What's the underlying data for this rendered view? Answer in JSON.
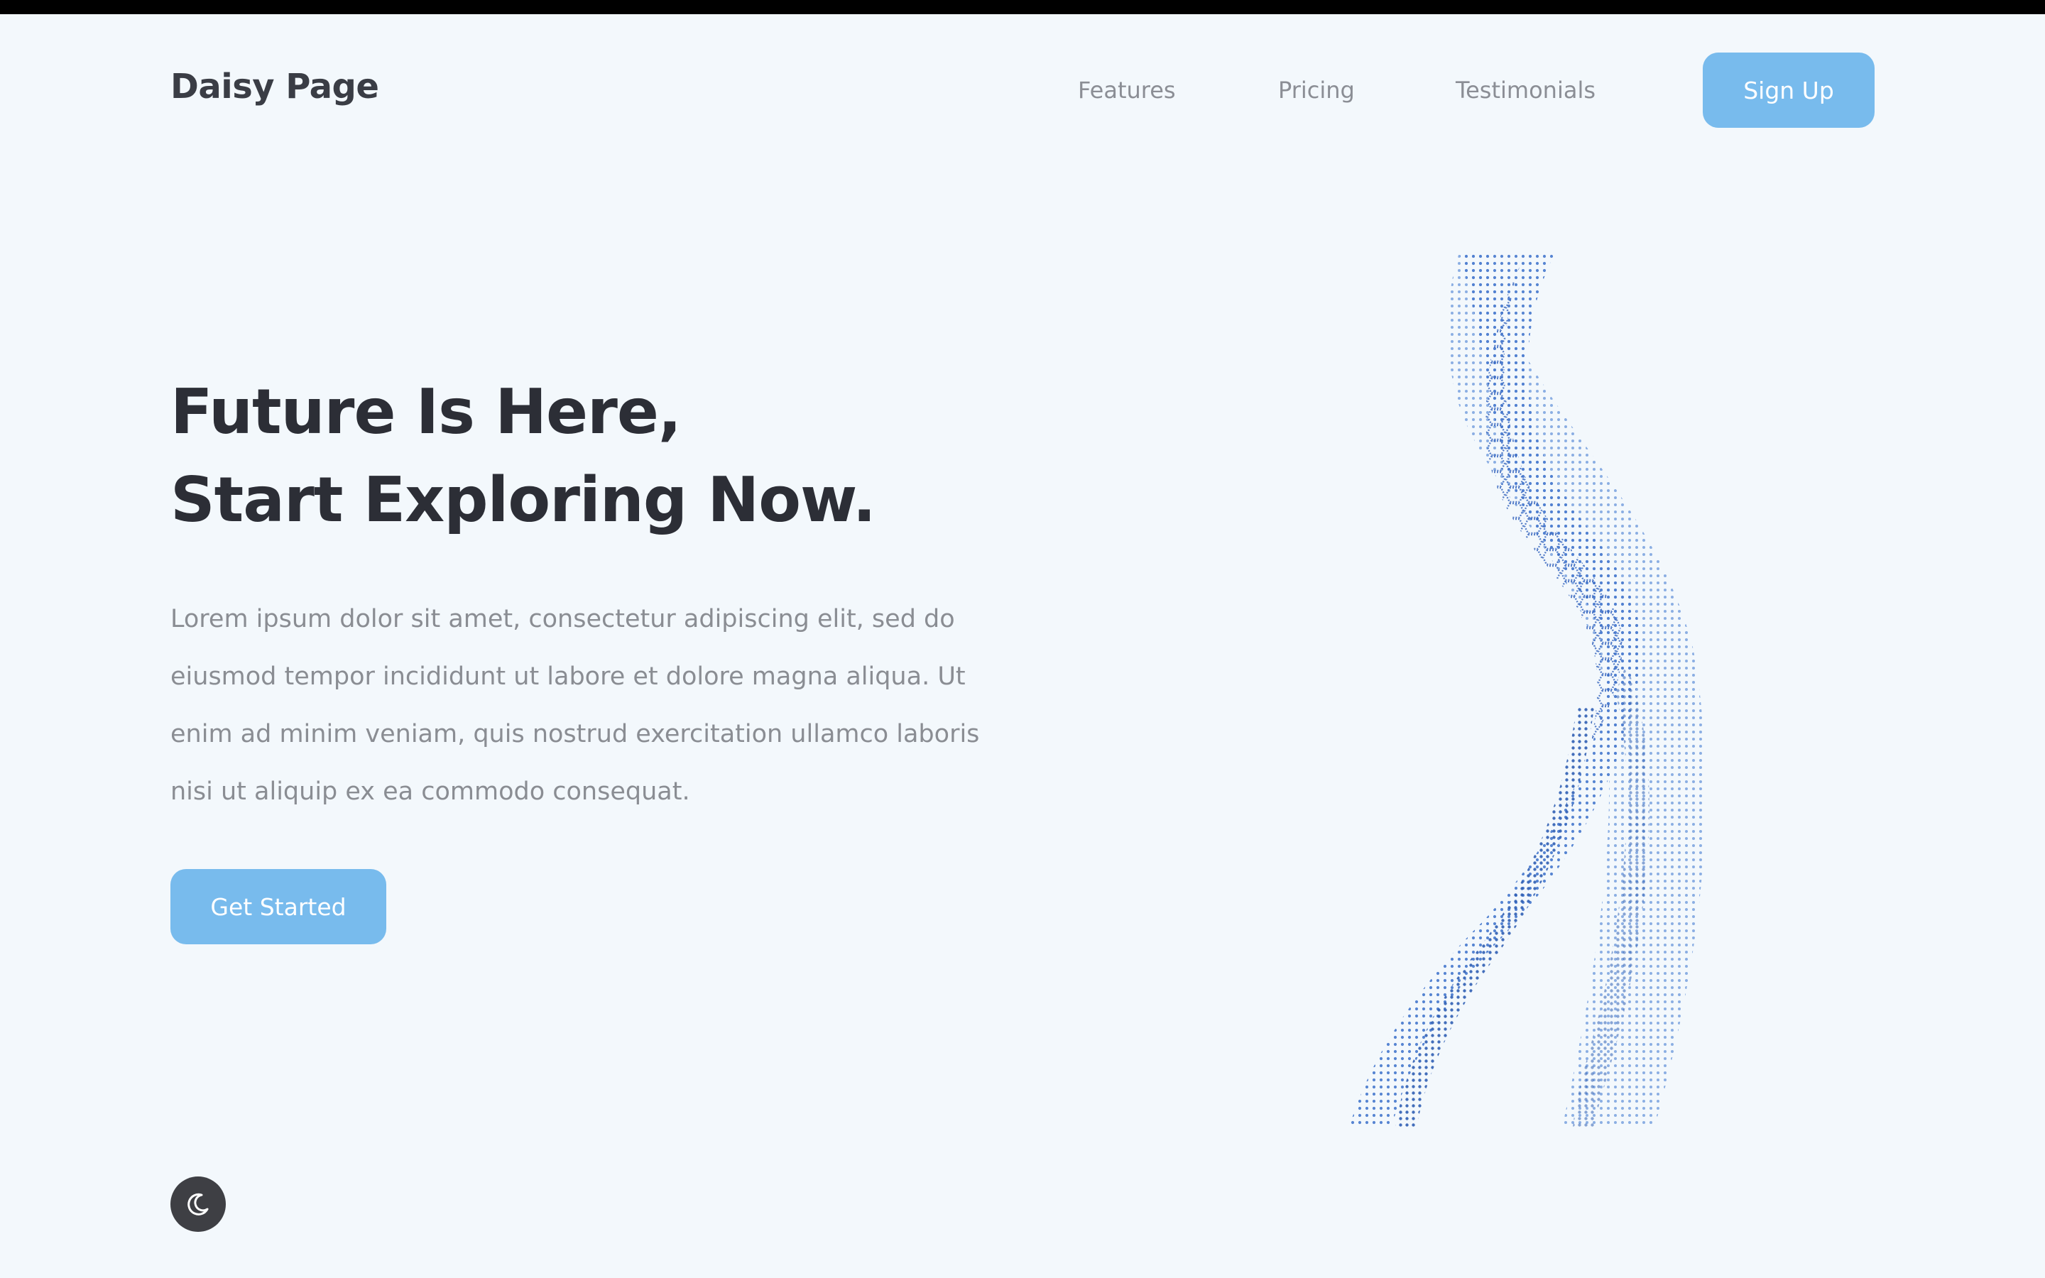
{
  "brand": {
    "name": "Daisy Page"
  },
  "nav": {
    "items": [
      {
        "label": "Features"
      },
      {
        "label": "Pricing"
      },
      {
        "label": "Testimonials"
      }
    ],
    "cta_label": "Sign Up"
  },
  "hero": {
    "title_line1": "Future Is Here,",
    "title_line2": "Start Exploring Now.",
    "body_lines": [
      "Lorem ipsum dolor sit amet, consectetur adipiscing elit, sed do",
      "eiusmod tempor incididunt ut labore et dolore magna aliqua. Ut",
      "enim ad minim veniam, quis nostrud exercitation ullamco laboris",
      "nisi ut aliquip ex ea commodo consequat."
    ],
    "cta_label": "Get Started"
  },
  "illustration": {
    "icon": "ribbon-illustration",
    "colors": [
      "#2f5fb4",
      "#4f7fd0",
      "#8fb4e8"
    ]
  },
  "theme_toggle": {
    "icon": "moon-icon"
  },
  "colors": {
    "background": "#f3f8fc",
    "accent": "#78bbed",
    "heading": "#2c2e36",
    "muted": "#8a8d93"
  }
}
